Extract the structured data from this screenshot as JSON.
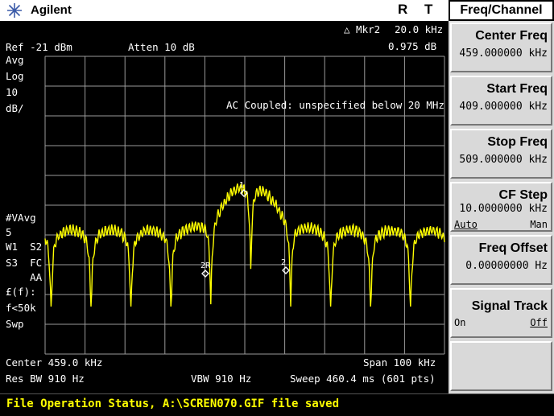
{
  "header": {
    "brand": "Agilent",
    "indicator_r": "R",
    "indicator_t": "T",
    "logo_icon": "agilent-spark-logo"
  },
  "screen": {
    "marker_readout_label": "△ Mkr2",
    "marker_readout_freq": "20.0 kHz",
    "marker_readout_amp": "0.975 dB",
    "ref_level": "Ref -21 dBm",
    "atten": "Atten 10 dB",
    "left_annotations": [
      "Avg",
      "Log",
      "10",
      "dB/"
    ],
    "ac_coupled_note": "AC Coupled: unspecified below 20 MHz",
    "left_annotations_lower": [
      "#VAvg",
      "5",
      "W1  S2",
      "S3  FC",
      "    AA",
      "£(f):",
      "f<50k",
      "Swp"
    ],
    "center": "Center 459.0 kHz",
    "span": "Span 100 kHz",
    "rbw": "Res BW 910 Hz",
    "vbw": "VBW 910 Hz",
    "sweep": "Sweep 460.4 ms (601 pts)",
    "marker_labels": [
      "1",
      "2R",
      "2"
    ],
    "trace_color": "#ffff00"
  },
  "status_bar": {
    "text": "File Operation Status, A:\\SCREN070.GIF file saved"
  },
  "softkey_menu": {
    "title": "Freq/Channel",
    "keys": [
      {
        "label": "Center Freq",
        "value": "459.000000 kHz"
      },
      {
        "label": "Start Freq",
        "value": "409.000000 kHz"
      },
      {
        "label": "Stop Freq",
        "value": "509.000000 kHz"
      },
      {
        "label": "CF Step",
        "value": "10.0000000 kHz",
        "opt_left": "Auto",
        "opt_right": "Man"
      },
      {
        "label": "Freq Offset",
        "value": "0.00000000  Hz"
      },
      {
        "label": "Signal Track",
        "value": "",
        "opt_left": "On",
        "opt_right": "Off"
      },
      {
        "label": "",
        "value": ""
      }
    ]
  }
}
